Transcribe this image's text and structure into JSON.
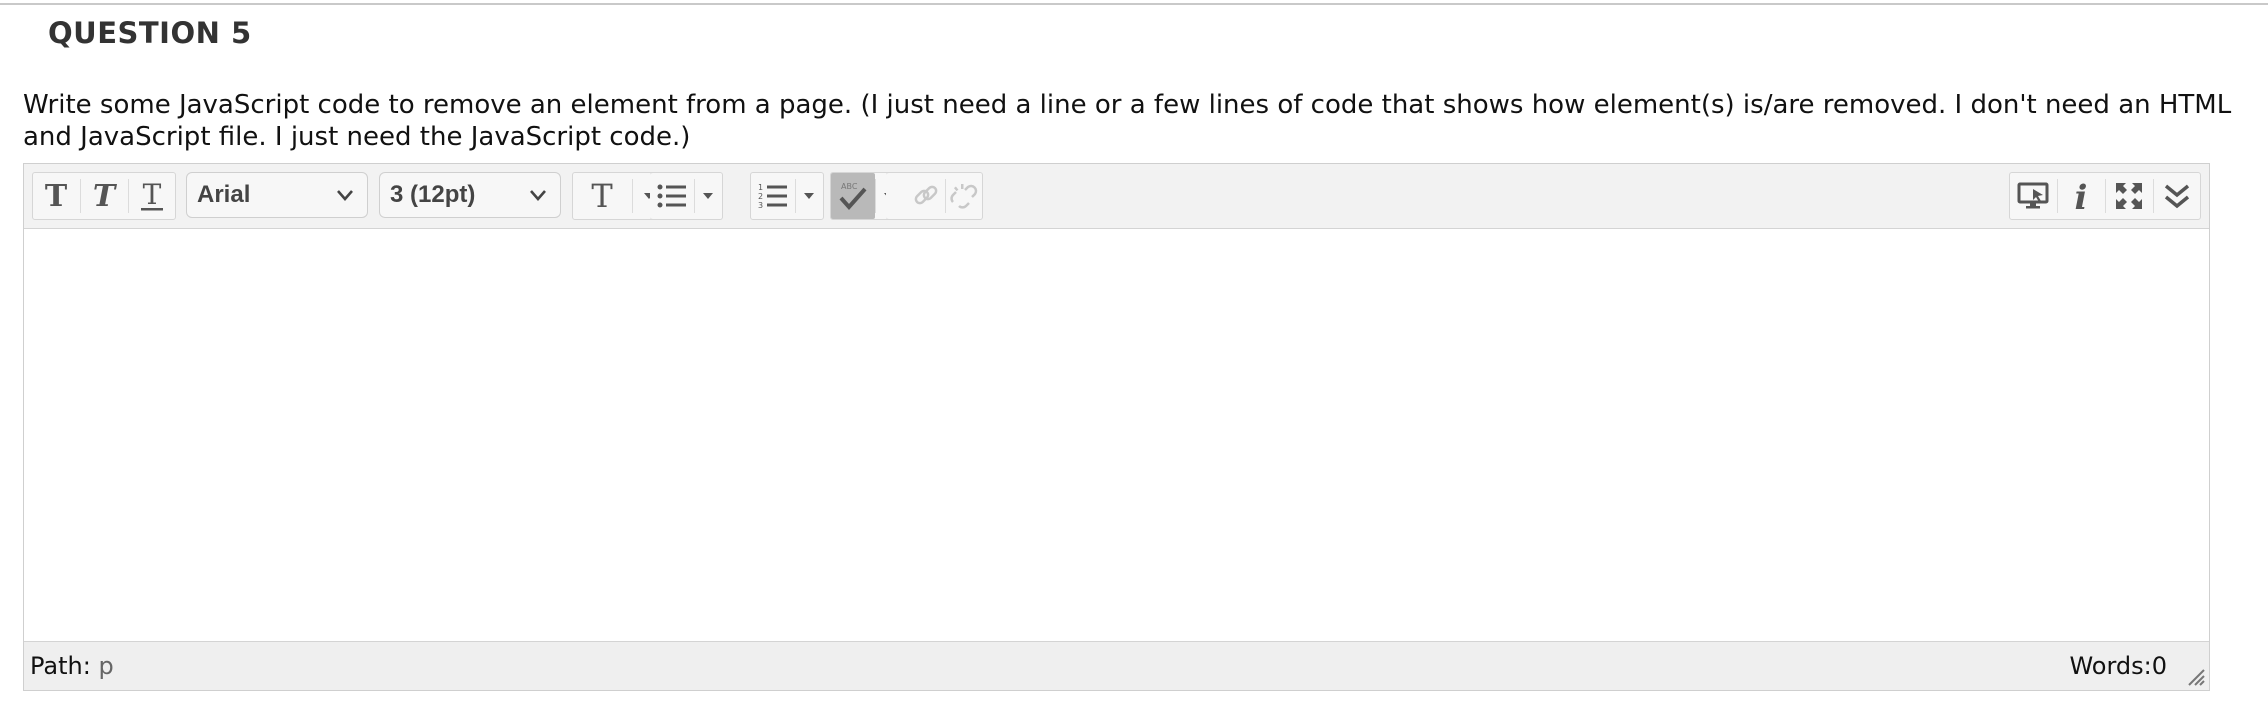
{
  "question": {
    "title": "QUESTION 5",
    "text": "Write some JavaScript code to remove an element from a page. (I just need a line or a few lines of code that shows how element(s) is/are removed. I don't need an HTML and JavaScript file. I just need the JavaScript code.)"
  },
  "toolbar": {
    "font_family": "Arial",
    "font_size": "3 (12pt)",
    "icons": [
      "bold-icon",
      "italic-icon",
      "underline-icon",
      "text-color-icon",
      "bullet-list-icon",
      "numbered-list-icon",
      "spellcheck-icon",
      "link-icon",
      "unlink-icon",
      "preview-icon",
      "info-icon",
      "fullscreen-icon",
      "collapse-toolbar-icon"
    ]
  },
  "status": {
    "path_label": "Path:",
    "path_value": "p",
    "words": "Words:0"
  },
  "colors": {
    "toolbar_bg": "#f2f2f2",
    "statusbar_bg": "#efefef",
    "border": "#cfcfcf",
    "icon": "#555555"
  }
}
